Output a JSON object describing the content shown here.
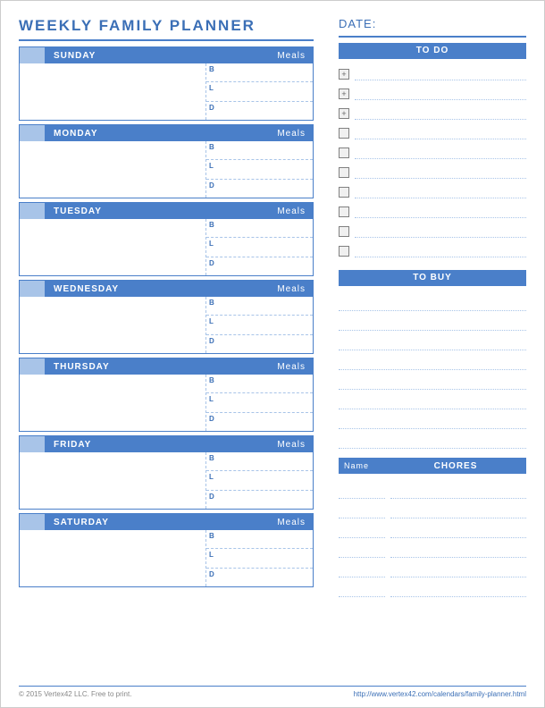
{
  "title": "WEEKLY FAMILY PLANNER",
  "date_label": "DATE:",
  "meals_label": "Meals",
  "meal_codes": {
    "b": "B",
    "l": "L",
    "d": "D"
  },
  "days": [
    {
      "name": "SUNDAY"
    },
    {
      "name": "MONDAY"
    },
    {
      "name": "TUESDAY"
    },
    {
      "name": "WEDNESDAY"
    },
    {
      "name": "THURSDAY"
    },
    {
      "name": "FRIDAY"
    },
    {
      "name": "SATURDAY"
    }
  ],
  "sections": {
    "todo": "TO DO",
    "tobuy": "TO BUY",
    "chores": "CHORES",
    "chores_name_col": "Name"
  },
  "todo_items": [
    {
      "marker": "+"
    },
    {
      "marker": "+"
    },
    {
      "marker": "+"
    },
    {
      "marker": ""
    },
    {
      "marker": ""
    },
    {
      "marker": ""
    },
    {
      "marker": ""
    },
    {
      "marker": ""
    },
    {
      "marker": ""
    },
    {
      "marker": ""
    }
  ],
  "tobuy_lines": 8,
  "chore_lines": 6,
  "footer": {
    "copyright": "© 2015 Vertex42 LLC. Free to print.",
    "url": "http://www.vertex42.com/calendars/family-planner.html"
  }
}
